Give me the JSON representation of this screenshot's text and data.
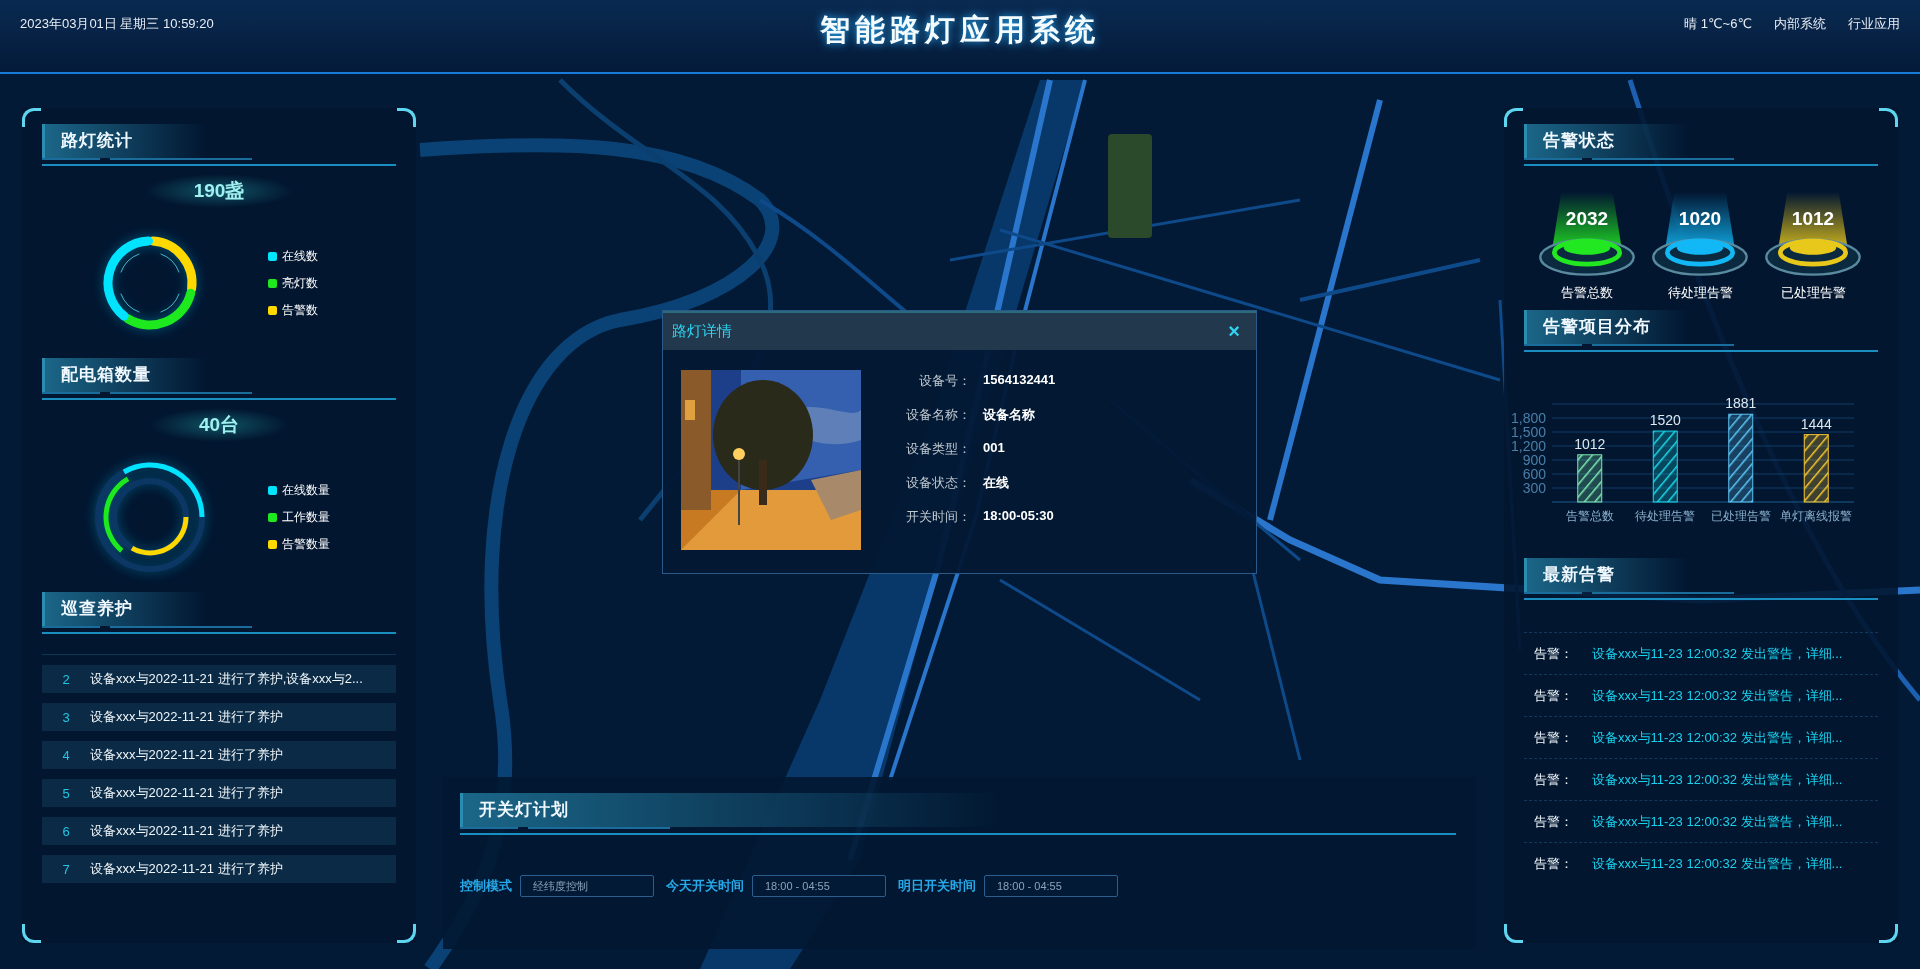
{
  "header": {
    "datetime": "2023年03月01日 星期三 10:59:20",
    "title": "智能路灯应用系统",
    "weather": "晴 1℃~6℃",
    "nav": [
      {
        "label": "内部系统"
      },
      {
        "label": "行业应用"
      }
    ]
  },
  "left_panel": {
    "lamp_stats": {
      "title": "路灯统计",
      "total": "190盏",
      "legend": [
        {
          "label": "在线数",
          "color": "#00e4ff"
        },
        {
          "label": "亮灯数",
          "color": "#1ee81e"
        },
        {
          "label": "告警数",
          "color": "#ffd800"
        }
      ]
    },
    "box_stats": {
      "title": "配电箱数量",
      "total": "40台",
      "legend": [
        {
          "label": "在线数量",
          "color": "#00e4ff"
        },
        {
          "label": "工作数量",
          "color": "#1ee81e"
        },
        {
          "label": "告警数量",
          "color": "#ffd800"
        }
      ]
    },
    "maintenance": {
      "title": "巡查养护",
      "rows": [
        {
          "index": "2",
          "text": "设备xxx与2022-11-21 进行了养护,设备xxx与2..."
        },
        {
          "index": "3",
          "text": "设备xxx与2022-11-21 进行了养护"
        },
        {
          "index": "4",
          "text": "设备xxx与2022-11-21 进行了养护"
        },
        {
          "index": "5",
          "text": "设备xxx与2022-11-21 进行了养护"
        },
        {
          "index": "6",
          "text": "设备xxx与2022-11-21 进行了养护"
        },
        {
          "index": "7",
          "text": "设备xxx与2022-11-21 进行了养护"
        }
      ]
    }
  },
  "right_panel": {
    "alarm_status": {
      "title": "告警状态",
      "items": [
        {
          "value": "2032",
          "label": "告警总数",
          "color": "#22e822"
        },
        {
          "value": "1020",
          "label": "待处理告警",
          "color": "#12b8f5"
        },
        {
          "value": "1012",
          "label": "已处理告警",
          "color": "#e8c81a"
        }
      ]
    },
    "alarm_distribution": {
      "title": "告警项目分布",
      "chart_data": {
        "type": "bar",
        "categories": [
          "告警总数",
          "待处理告警",
          "已处理告警",
          "单灯离线报警"
        ],
        "values": [
          1012,
          1520,
          1881,
          1444
        ],
        "colors": [
          "#7de8b0",
          "#1ad8e8",
          "#5cc4f4",
          "#f5c530"
        ],
        "grid": true,
        "ylim": [
          0,
          2100
        ],
        "yticks": [
          {
            "value": 300,
            "label": "300"
          },
          {
            "value": 600,
            "label": "600"
          },
          {
            "value": 900,
            "label": "900"
          },
          {
            "value": 1200,
            "label": "1,200"
          },
          {
            "value": 1500,
            "label": "1,500"
          },
          {
            "value": 1800,
            "label": "1,800"
          }
        ],
        "value_labels": [
          "1012",
          "1520",
          "1881",
          "1444"
        ]
      }
    },
    "latest_alarms": {
      "title": "最新告警",
      "rows": [
        {
          "label": "告警：",
          "text": "设备xxx与11-23 12:00:32 发出警告，详细..."
        },
        {
          "label": "告警：",
          "text": "设备xxx与11-23 12:00:32 发出警告，详细..."
        },
        {
          "label": "告警：",
          "text": "设备xxx与11-23 12:00:32 发出警告，详细..."
        },
        {
          "label": "告警：",
          "text": "设备xxx与11-23 12:00:32 发出警告，详细..."
        },
        {
          "label": "告警：",
          "text": "设备xxx与11-23 12:00:32 发出警告，详细..."
        },
        {
          "label": "告警：",
          "text": "设备xxx与11-23 12:00:32 发出警告，详细..."
        }
      ]
    }
  },
  "detail_dialog": {
    "title": "路灯详情",
    "close": "×",
    "fields": [
      {
        "label": "设备号：",
        "value": "1564132441"
      },
      {
        "label": "设备名称：",
        "value": "设备名称"
      },
      {
        "label": "设备类型：",
        "value": "001"
      },
      {
        "label": "设备状态：",
        "value": "在线"
      },
      {
        "label": "开关时间：",
        "value": "18:00-05:30"
      }
    ]
  },
  "schedule": {
    "title": "开关灯计划",
    "fields": [
      {
        "label": "控制模式",
        "value": "经纬度控制"
      },
      {
        "label": "今天开关时间",
        "value": "18:00 - 04:55"
      },
      {
        "label": "明日开关时间",
        "value": "18:00 - 04:55"
      }
    ]
  }
}
